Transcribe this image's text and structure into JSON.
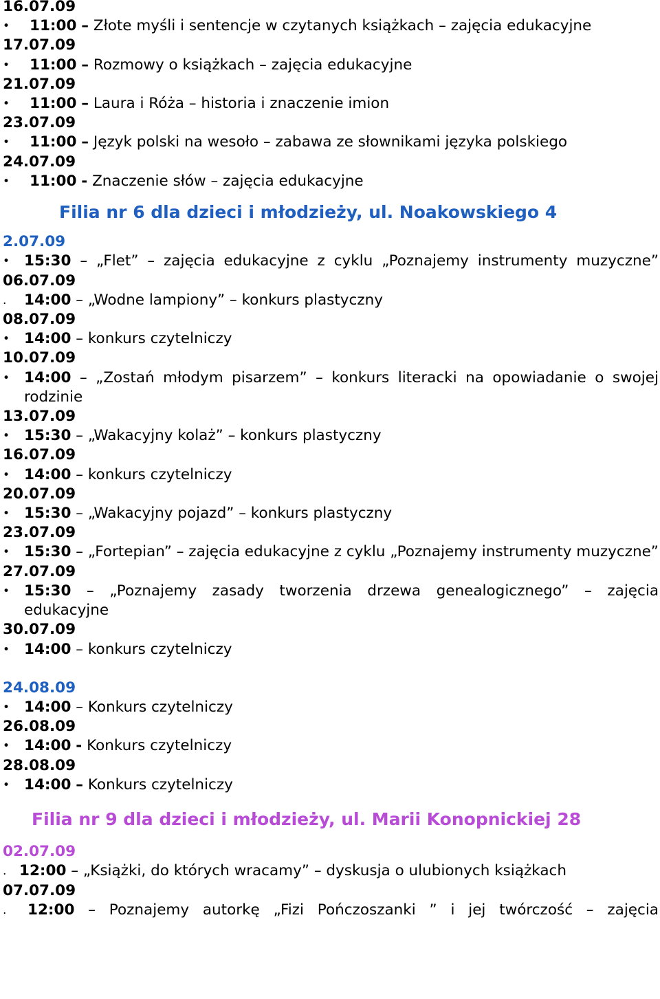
{
  "section1": {
    "rows": [
      {
        "date": "16.07.09",
        "time": "11:00",
        "sep": "–",
        "text": "Złote myśli i sentencje w czytanych książkach – zajęcia edukacyjne"
      },
      {
        "date": "17.07.09",
        "time": "11:00",
        "sep": "–",
        "text": "Rozmowy o książkach – zajęcia edukacyjne"
      },
      {
        "date": "21.07.09",
        "time": "11:00",
        "sep": "–",
        "text": "Laura i Róża – historia i znaczenie imion"
      },
      {
        "date": "23.07.09",
        "time": "11:00",
        "sep": "–",
        "text": "Język polski na wesoło – zabawa ze słownikami języka polskiego"
      },
      {
        "date": "24.07.09",
        "time": "11:00",
        "sep": "-",
        "text": "Znaczenie słów – zajęcia edukacyjne"
      }
    ]
  },
  "section2": {
    "heading": "Filia nr 6 dla dzieci i młodzieży, ul. Noakowskiego 4",
    "rows": [
      {
        "date": "2.07.09",
        "bullet": "•",
        "time": "15:30",
        "text": "– „Flet” – zajęcia edukacyjne z cyklu „Poznajemy instrumenty muzyczne”"
      },
      {
        "date": "06.07.09",
        "bullet": ".",
        "time": "14:00",
        "text": "– „Wodne lampiony” – konkurs plastyczny"
      },
      {
        "date": "08.07.09",
        "bullet": "•",
        "time": "14:00",
        "text": "– konkurs czytelniczy"
      },
      {
        "date": "10.07.09",
        "bullet": "•",
        "time": "14:00",
        "text": "– „Zostań młodym pisarzem” – konkurs literacki na opowiadanie o swojej rodzinie"
      },
      {
        "date": "13.07.09",
        "bullet": "•",
        "time": "15:30",
        "text": "– „Wakacyjny kolaż” – konkurs plastyczny"
      },
      {
        "date": "16.07.09",
        "bullet": "•",
        "time": "14:00",
        "text": "– konkurs czytelniczy"
      },
      {
        "date": "20.07.09",
        "bullet": "•",
        "time": "15:30",
        "text": "– „Wakacyjny pojazd” – konkurs plastyczny"
      },
      {
        "date": "23.07.09",
        "bullet": "•",
        "time": "15:30",
        "text": "– „Fortepian” – zajęcia edukacyjne z cyklu „Poznajemy instrumenty muzyczne”"
      },
      {
        "date": "27.07.09",
        "bullet": "•",
        "time": "15:30",
        "text": "– „Poznajemy zasady tworzenia drzewa genealogicznego” – zajęcia edukacyjne"
      },
      {
        "date": "30.07.09",
        "bullet": "•",
        "time": "14:00",
        "text": "– konkurs czytelniczy"
      }
    ],
    "rows_aug": [
      {
        "date": "24.08.09",
        "bullet": "•",
        "time": "14:00",
        "sep": "–",
        "text": "Konkurs czytelniczy"
      },
      {
        "date": "26.08.09",
        "bullet": "•",
        "time": "14:00",
        "sep": "-",
        "text": "Konkurs czytelniczy"
      },
      {
        "date": "28.08.09",
        "bullet": "•",
        "time": "14:00",
        "sep": "–",
        "text": "Konkurs czytelniczy"
      }
    ]
  },
  "section3": {
    "heading": "Filia nr 9 dla dzieci i młodzieży, ul. Marii Konopnickiej 28",
    "rows": [
      {
        "date": "02.07.09",
        "bullet": ".",
        "time": "12:00",
        "text": "– „Książki, do których wracamy” – dyskusja o ulubionych książkach"
      },
      {
        "date": "07.07.09",
        "bullet": ".",
        "time": "12:00",
        "text": "– Poznajemy autorkę „Fizi Pończoszanki ” i jej twórczość – zajęcia"
      }
    ]
  },
  "colors": {
    "date_blue": "#1f5fbf",
    "heading_magenta": "#b84cd6",
    "text": "#000000"
  }
}
